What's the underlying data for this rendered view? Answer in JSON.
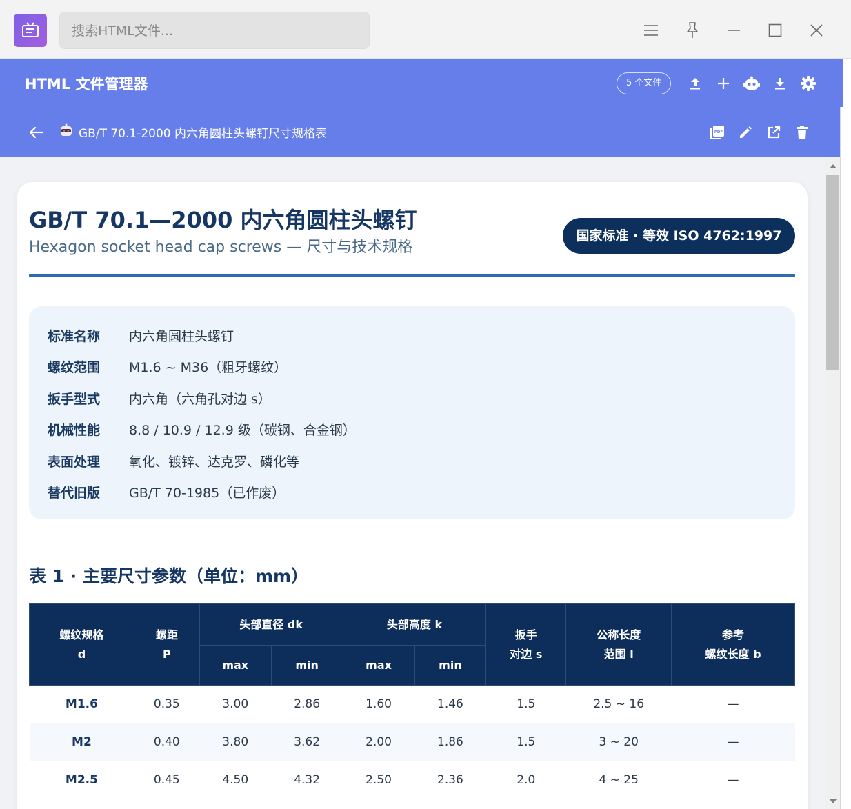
{
  "window": {
    "search_placeholder": "搜索HTML文件..."
  },
  "header": {
    "app_title": "HTML 文件管理器",
    "file_count": "5 个文件",
    "brand_color": "#667eea"
  },
  "file_bar": {
    "file_name": "GB/T 70.1-2000 内六角圆柱头螺钉尺寸规格表"
  },
  "document": {
    "title": "GB/T 70.1—2000 内六角圆柱头螺钉",
    "subtitle": "Hexagon socket head cap screws — 尺寸与技术规格",
    "badge": "国家标准 · 等效 ISO 4762:1997",
    "info": [
      {
        "label": "标准名称",
        "value": "内六角圆柱头螺钉"
      },
      {
        "label": "螺纹范围",
        "value": "M1.6 ~ M36（粗牙螺纹）"
      },
      {
        "label": "扳手型式",
        "value": "内六角（六角孔对边 s）"
      },
      {
        "label": "机械性能",
        "value": "8.8 / 10.9 / 12.9 级（碳钢、合金钢）"
      },
      {
        "label": "表面处理",
        "value": "氧化、镀锌、达克罗、磷化等"
      },
      {
        "label": "替代旧版",
        "value": "GB/T 70-1985（已作废）"
      }
    ],
    "table_title": "表 1 · 主要尺寸参数（单位：mm）",
    "table": {
      "headers": {
        "d_line1": "螺纹规格",
        "d_line2": "d",
        "p_line1": "螺距",
        "p_line2": "P",
        "dk": "头部直径 dk",
        "k": "头部高度 k",
        "max": "max",
        "min": "min",
        "s_line1": "扳手",
        "s_line2": "对边 s",
        "l_line1": "公称长度",
        "l_line2": "范围 l",
        "b_line1": "参考",
        "b_line2": "螺纹长度 b"
      },
      "rows": [
        {
          "d": "M1.6",
          "p": "0.35",
          "dk_max": "3.00",
          "dk_min": "2.86",
          "k_max": "1.60",
          "k_min": "1.46",
          "s": "1.5",
          "l": "2.5 ~ 16",
          "b": "—"
        },
        {
          "d": "M2",
          "p": "0.40",
          "dk_max": "3.80",
          "dk_min": "3.62",
          "k_max": "2.00",
          "k_min": "1.86",
          "s": "1.5",
          "l": "3 ~ 20",
          "b": "—"
        },
        {
          "d": "M2.5",
          "p": "0.45",
          "dk_max": "4.50",
          "dk_min": "4.32",
          "k_max": "2.50",
          "k_min": "2.36",
          "s": "2.0",
          "l": "4 ~ 25",
          "b": "—"
        }
      ]
    }
  }
}
